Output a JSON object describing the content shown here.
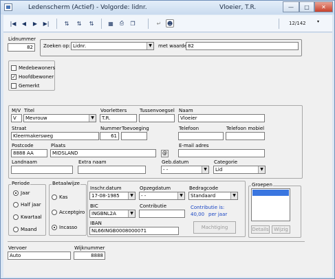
{
  "window": {
    "title": "Ledenscherm (Actief) - Volgorde: lidnr.",
    "title_right": "Vloeier, T.R.",
    "record_counter": "12/142"
  },
  "icons": [
    "first-record-icon",
    "prev-record-icon",
    "next-record-icon",
    "last-record-icon",
    "sort-asc-icon",
    "sort-desc-icon",
    "sort-icon",
    "table-icon",
    "print-icon",
    "copy-icon",
    "exit-icon",
    "help-icon"
  ],
  "lidnummer": {
    "label": "Lidnummer",
    "value": "82"
  },
  "search": {
    "label": "Zoeken op:",
    "field": "Lidnr.",
    "value_label": "met waarde:",
    "value": "82"
  },
  "flags": [
    {
      "label": "Medebewoners",
      "checked": false
    },
    {
      "label": "Hoofdbewoner",
      "checked": true
    },
    {
      "label": "Gemerkt",
      "checked": false
    }
  ],
  "person": {
    "mv_label": "M/V",
    "mv": "V",
    "titel_label": "Titel",
    "titel": "Mevrouw",
    "voorletters_label": "Voorletters",
    "voorletters": "T.R.",
    "tussenvoegsel_label": "Tussenvoegsel",
    "tussenvoegsel": "",
    "naam_label": "Naam",
    "naam": "Vloeier",
    "straat_label": "Straat",
    "straat": "Kleermakersweg",
    "nummer_label": "Nummer",
    "nummer": "61",
    "toevoeging_label": "Toevoeging",
    "toevoeging": "",
    "telefoon_label": "Telefoon",
    "telefoon": "",
    "telefoon_mobiel_label": "Telefoon mobiel",
    "telefoon_mobiel": "",
    "postcode_label": "Postcode",
    "postcode": "8888 AA",
    "plaats_label": "Plaats",
    "plaats": "MIDSLAND",
    "email_label": "E-mail adres",
    "email": "",
    "email_icon": "@",
    "landnaam_label": "Landnaam",
    "landnaam": "",
    "extra_naam_label": "Extra naam",
    "extra_naam": "",
    "geb_datum_label": "Geb.datum",
    "geb_datum": " -  - ",
    "categorie_label": "Categorie",
    "categorie": "Lid"
  },
  "periode": {
    "title": "Periode",
    "options": [
      {
        "label": "Jaar",
        "selected": true
      },
      {
        "label": "Half jaar",
        "selected": false
      },
      {
        "label": "Kwartaal",
        "selected": false
      },
      {
        "label": "Maand",
        "selected": false
      }
    ]
  },
  "betaalwijze": {
    "title": "Betaalwijze",
    "options": [
      {
        "label": "Kas",
        "selected": false
      },
      {
        "label": "Acceptgiro",
        "selected": false
      },
      {
        "label": "Incasso",
        "selected": true
      }
    ]
  },
  "payment": {
    "inschr_label": "Inschr.datum",
    "inschr": "17-08-1985",
    "opzeg_label": "Opzegdatum",
    "opzeg": " -  - ",
    "bedragcode_label": "Bedragcode",
    "bedragcode": "Standaard",
    "bic_label": "BIC",
    "bic": "INGBNL2A",
    "contributie_label": "Contributie",
    "contributie": "",
    "contributie_is": "Contributie is:",
    "contributie_amount": "40,00",
    "contributie_period": "per jaar",
    "iban_label": "IBAN",
    "iban": "NL66INGB0008000071",
    "machtiging": "Machtiging"
  },
  "groepen": {
    "title": "Groepen",
    "details": "Details",
    "wijzig": "Wijzig"
  },
  "vervoer": {
    "label": "Vervoer",
    "value": "Auto"
  },
  "wijknummer": {
    "label": "Wijknummer",
    "value": "8888"
  }
}
